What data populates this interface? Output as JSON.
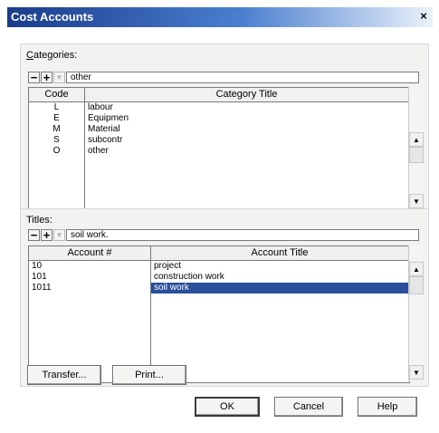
{
  "window": {
    "title": "Cost Accounts",
    "close_glyph": "×"
  },
  "categories": {
    "label_first": "C",
    "label_rest": "ategories:",
    "nav": {
      "minus": "−",
      "plus": "+",
      "arrow": "▼",
      "current_value": "other"
    },
    "columns": [
      "Code",
      "Category Title"
    ],
    "rows": [
      {
        "code": "L",
        "title": "labour"
      },
      {
        "code": "E",
        "title": "Equipmen"
      },
      {
        "code": "M",
        "title": "Material"
      },
      {
        "code": "S",
        "title": "subcontr"
      },
      {
        "code": "O",
        "title": "other"
      }
    ]
  },
  "titles": {
    "label": "Titles:",
    "nav": {
      "minus": "−",
      "plus": "+",
      "arrow": "▼",
      "current_value": "soil work."
    },
    "columns": [
      "Account #",
      "Account Title"
    ],
    "rows": [
      {
        "account": "10",
        "title": "project",
        "selected": false
      },
      {
        "account": "101",
        "title": "construction work",
        "selected": false
      },
      {
        "account": "1011",
        "title": "soil work",
        "selected": true
      }
    ]
  },
  "scroll": {
    "up": "▲",
    "down": "▼"
  },
  "buttons": {
    "transfer": "Transfer...",
    "print": "Print...",
    "ok": "OK",
    "cancel": "Cancel",
    "help": "Help"
  }
}
